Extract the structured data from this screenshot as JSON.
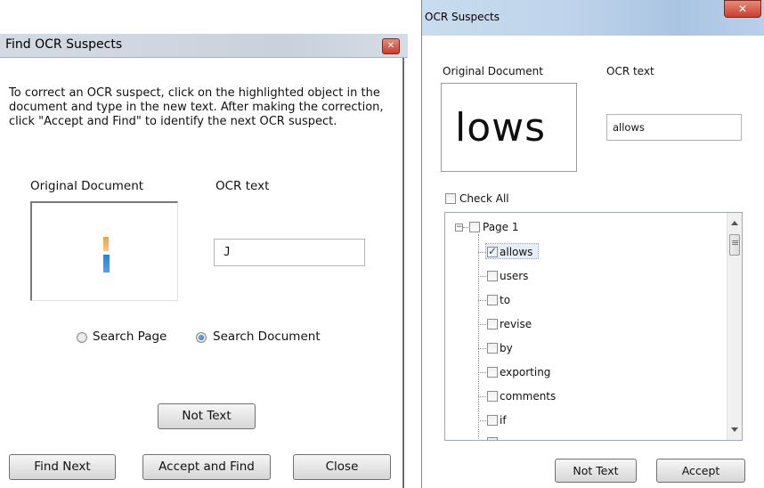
{
  "find_dialog": {
    "title": "Find OCR Suspects",
    "instructions": "To correct an OCR suspect, click on the highlighted object in the document and type in the new text. After making the correction, click \"Accept and Find\" to identify the next OCR suspect.",
    "original_document_label": "Original Document",
    "ocr_text_label": "OCR text",
    "ocr_text_value": "J",
    "radio_search_page": "Search Page",
    "radio_search_document": "Search Document",
    "selected_scope": "Search Document",
    "not_text_button": "Not Text",
    "find_next_button": "Find Next",
    "accept_and_find_button": "Accept and Find",
    "close_button": "Close"
  },
  "suspects_dialog": {
    "title": "OCR Suspects",
    "original_document_label": "Original Document",
    "ocr_text_label": "OCR text",
    "original_word_image_text": "lows",
    "ocr_text_value": "allows",
    "check_all_label": "Check All",
    "tree": {
      "root_label": "Page 1",
      "items": [
        {
          "label": "allows",
          "checked": true
        },
        {
          "label": "users",
          "checked": false
        },
        {
          "label": "to",
          "checked": false
        },
        {
          "label": "revise",
          "checked": false
        },
        {
          "label": "by",
          "checked": false
        },
        {
          "label": "exporting",
          "checked": false
        },
        {
          "label": "comments",
          "checked": false
        },
        {
          "label": "if",
          "checked": false
        }
      ]
    },
    "not_text_button": "Not Text",
    "accept_button": "Accept"
  },
  "colors": {
    "left_titlebar": "#cfd6df",
    "right_titlebar": "#bed3ea",
    "close_button": "#c8402c",
    "radio_selected": "#1d5fb0"
  },
  "icons": {
    "close": "close-icon",
    "expander": "collapse-minus-icon",
    "scroll_up": "scroll-up-arrow-icon",
    "scroll_down": "scroll-down-arrow-icon"
  }
}
